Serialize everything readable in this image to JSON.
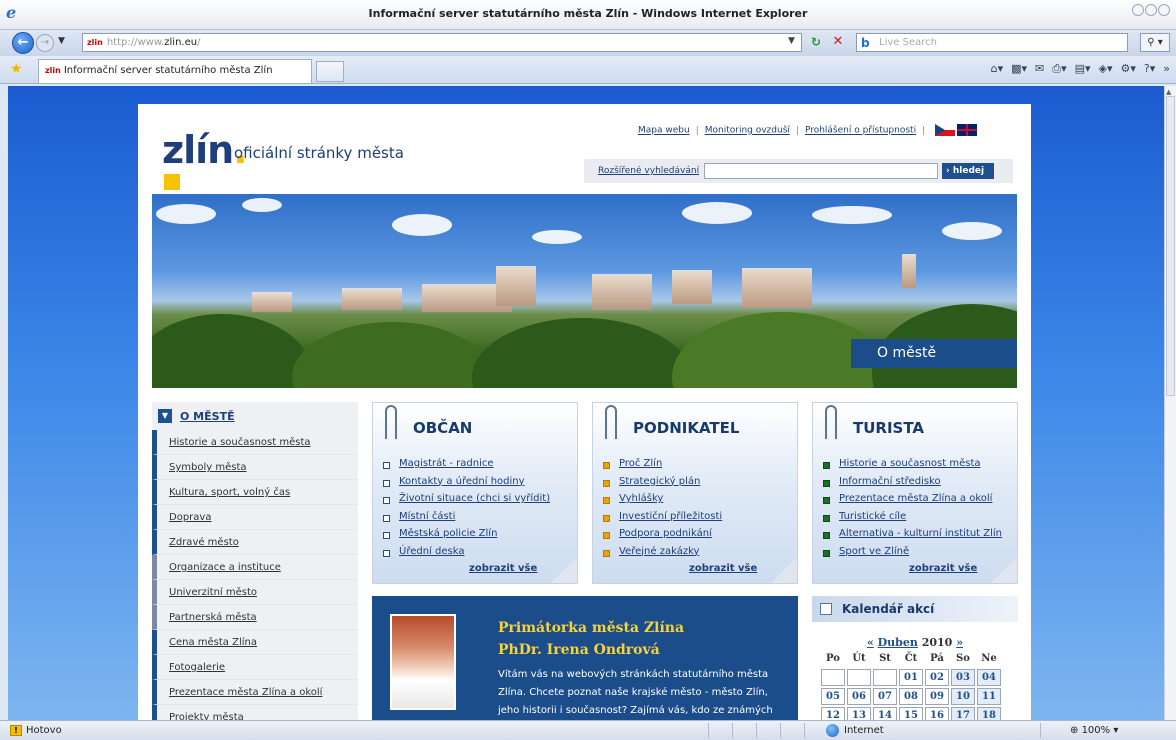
{
  "browser": {
    "window_title": "Informační server statutárního města Zlín - Windows Internet Explorer",
    "url_favicon": "zlin",
    "url_prefix": "http://www.",
    "url_domain": "zlin.eu",
    "url_suffix": "/",
    "search_placeholder": "Live Search",
    "tab_title": "Informační server statutárního města Zlín",
    "status_text": "Hotovo",
    "zone_text": "Internet",
    "zoom_text": "100%"
  },
  "site": {
    "logo_text": "zlín",
    "logo_dot": ".",
    "tagline": "oficiální stránky města",
    "top_links": [
      "Mapa webu",
      "Monitoring ovzduší",
      "Prohlášení o přístupnosti"
    ],
    "advanced_search": "Rozšířené vyhledávání",
    "search_button": "hledej",
    "banner_label": "O městě"
  },
  "left_nav": {
    "heading": "O MĚSTĚ",
    "items": [
      "Historie a současnost města",
      "Symboly města",
      "Kultura, sport, volný čas",
      "Doprava",
      "Zdravé město",
      "Organizace a instituce",
      "Univerzitní město",
      "Partnerská města",
      "Cena města Zlína",
      "Fotogalerie",
      "Prezentace města Zlína a okolí",
      "Projekty města"
    ]
  },
  "panels": [
    {
      "title": "OBČAN",
      "links": [
        "Magistrát - radnice",
        "Kontakty a úřední hodiny",
        "Životní situace (chci si vyřídit)",
        "Místní části",
        "Městská policie Zlín",
        "Úřední deska"
      ],
      "more": "zobrazit vše"
    },
    {
      "title": "PODNIKATEL",
      "links": [
        "Proč Zlín",
        "Strategický plán",
        "Vyhlášky",
        "Investiční příležitosti",
        "Podpora podnikání",
        "Veřejné zakázky"
      ],
      "more": "zobrazit vše"
    },
    {
      "title": "TURISTA",
      "links": [
        "Historie a současnost města",
        "Informační středisko",
        "Prezentace města Zlína a okolí",
        "Turistické cíle",
        "Alternativa - kulturní institut Zlín",
        "Sport ve Zlíně"
      ],
      "more": "zobrazit vše"
    }
  ],
  "mayor": {
    "heading": "Primátorka města Zlína",
    "name": "PhDr. Irena Ondrová",
    "text": "Vítám vás na webových stránkách statutárního města Zlína. Chcete poznat naše krajské město - město Zlín, jeho historii i současnost? Zajímá vás, kdo ze známých"
  },
  "calendar": {
    "title": "Kalendář akcí",
    "prev": "«",
    "month": "Duben",
    "year": "2010",
    "next": "»",
    "day_names": [
      "Po",
      "Út",
      "St",
      "Čt",
      "Pá",
      "So",
      "Ne"
    ],
    "week1": [
      "",
      "",
      "",
      "01",
      "02",
      "03",
      "04"
    ],
    "week2": [
      "05",
      "06",
      "07",
      "08",
      "09",
      "10",
      "11"
    ],
    "week3": [
      "12",
      "13",
      "14",
      "15",
      "16",
      "17",
      "18"
    ]
  }
}
